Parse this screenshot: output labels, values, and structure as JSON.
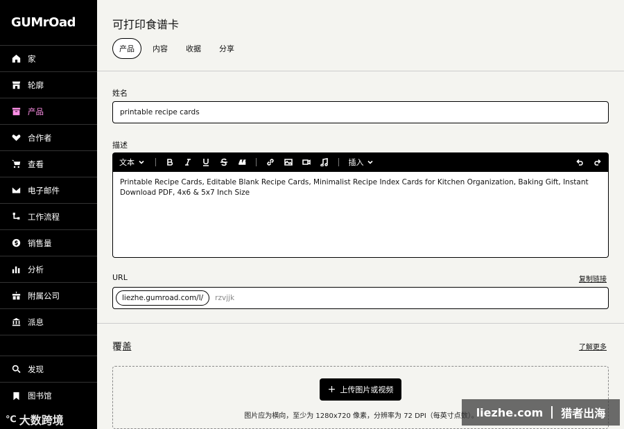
{
  "sidebar": {
    "logo": "GUMrOad",
    "items": [
      {
        "label": "家",
        "icon": "home-icon"
      },
      {
        "label": "轮廓",
        "icon": "store-icon"
      },
      {
        "label": "产品",
        "icon": "archive-icon",
        "active": true
      },
      {
        "label": "合作者",
        "icon": "handshake-icon"
      },
      {
        "label": "查看",
        "icon": "cart-icon"
      },
      {
        "label": "电子邮件",
        "icon": "envelope-icon"
      },
      {
        "label": "工作流程",
        "icon": "workflow-icon"
      },
      {
        "label": "销售量",
        "icon": "dollar-icon"
      },
      {
        "label": "分析",
        "icon": "bar-chart-icon"
      },
      {
        "label": "附属公司",
        "icon": "gift-icon"
      },
      {
        "label": "派息",
        "icon": "bank-icon"
      }
    ],
    "bottom_items": [
      {
        "label": "发现",
        "icon": "search-icon"
      },
      {
        "label": "图书馆",
        "icon": "bookmark-icon"
      }
    ]
  },
  "header": {
    "title": "可打印食谱卡",
    "tabs": [
      "产品",
      "内容",
      "收据",
      "分享"
    ]
  },
  "form": {
    "name_label": "姓名",
    "name_value": "printable recipe cards",
    "desc_label": "描述",
    "toolbar": {
      "text_style": "文本",
      "insert": "插入"
    },
    "desc_value": "Printable Recipe Cards, Editable Blank Recipe Cards, Minimalist Recipe Index Cards for Kitchen Organization, Baking Gift, Instant Download PDF, 4x6 & 5x7 Inch Size",
    "url_label": "URL",
    "copy_link": "复制链接",
    "url_prefix": "liezhe.gumroad.com/l/",
    "url_slug": "rzvjjk"
  },
  "cover": {
    "title": "覆盖",
    "learn_more": "了解更多",
    "upload_label": "上传图片或视频",
    "hint": "图片应为横向，至少为 1280x720 像素，分辨率为 72 DPI（每英寸点数）。"
  },
  "watermarks": {
    "left": "大数跨境",
    "right_site": "liezhe.com",
    "right_brand": "猎者出海"
  },
  "colors": {
    "accent": "#ff90e8",
    "sidebar_bg": "#000000",
    "page_bg": "#f4f4f0"
  }
}
